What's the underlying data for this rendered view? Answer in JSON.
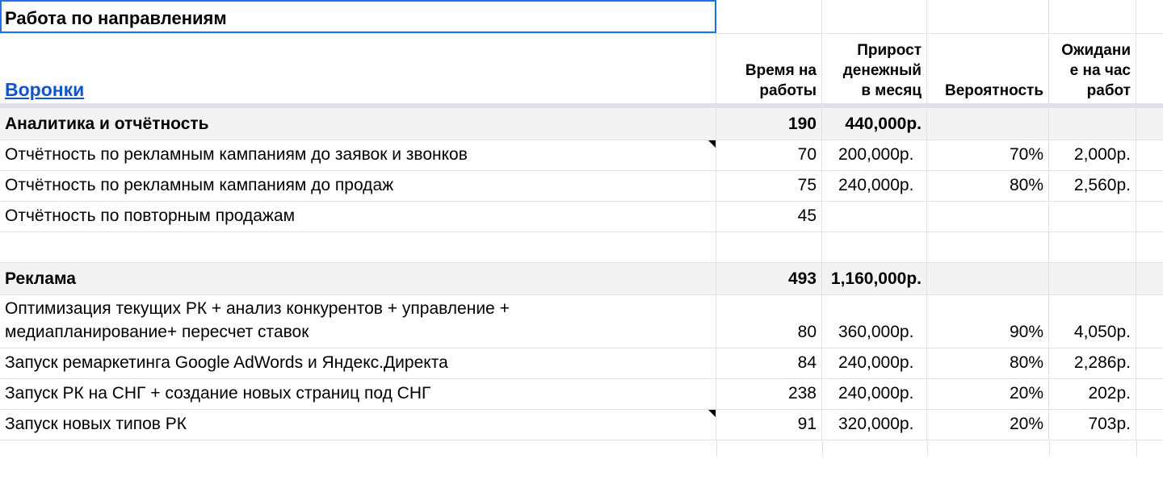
{
  "title": "Работа по направлениям",
  "link": "Воронки",
  "headers": {
    "time": [
      "Время на",
      "работы"
    ],
    "growth": [
      "Прирост",
      "денежный",
      "в месяц"
    ],
    "probability": [
      "Вероятность"
    ],
    "expectation": [
      "Ожидани",
      "е на час",
      "работ"
    ]
  },
  "groups": [
    {
      "name": "Аналитика и отчётность",
      "time": "190",
      "growth": "440,000р.",
      "rows": [
        {
          "name": "Отчётность по рекламным кампаниям до заявок и звонков",
          "time": "70",
          "growth": "200,000р.",
          "probability": "70%",
          "expectation": "2,000р.",
          "note": true
        },
        {
          "name": "Отчётность по рекламным кампаниям до продаж",
          "time": "75",
          "growth": "240,000р.",
          "probability": "80%",
          "expectation": "2,560р.",
          "note": false
        },
        {
          "name": "Отчётность по повторным продажам",
          "time": "45",
          "growth": "",
          "probability": "",
          "expectation": "",
          "note": false
        }
      ]
    },
    {
      "name": "Реклама",
      "time": "493",
      "growth": "1,160,000р.",
      "rows": [
        {
          "name_lines": [
            "Оптимизация текущих РК + анализ конкурентов + управление +",
            "медиапланирование+ пересчет ставок"
          ],
          "time": "80",
          "growth": "360,000р.",
          "probability": "90%",
          "expectation": "4,050р.",
          "note": false
        },
        {
          "name": "Запуск ремаркетинга Google AdWords и Яндекс.Директа",
          "time": "84",
          "growth": "240,000р.",
          "probability": "80%",
          "expectation": "2,286р.",
          "note": false
        },
        {
          "name": "Запуск РК на СНГ + создание новых страниц под СНГ",
          "time": "238",
          "growth": "240,000р.",
          "probability": "20%",
          "expectation": "202р.",
          "note": false
        },
        {
          "name": "Запуск новых типов РК",
          "time": "91",
          "growth": "320,000р.",
          "probability": "20%",
          "expectation": "703р.",
          "note": true
        }
      ]
    }
  ]
}
